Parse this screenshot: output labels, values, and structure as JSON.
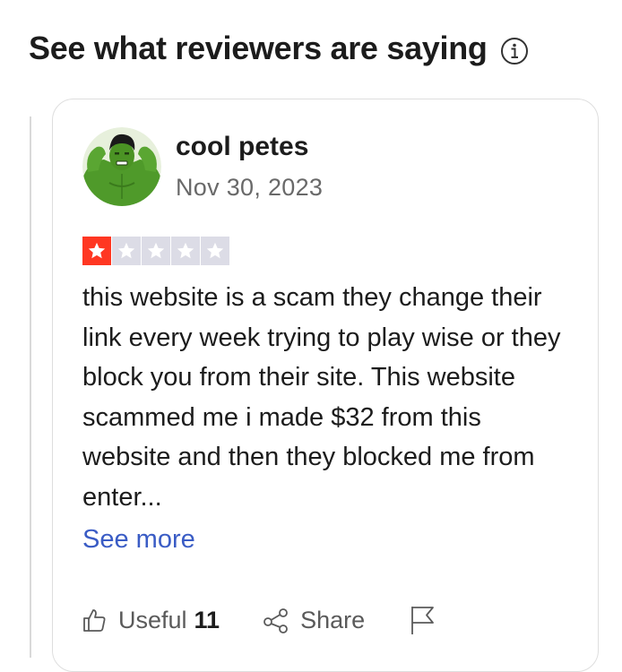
{
  "section": {
    "title": "See what reviewers are saying",
    "info_icon": "info-circle-icon"
  },
  "review": {
    "reviewer_name": "cool petes",
    "date": "Nov 30, 2023",
    "rating": 1,
    "rating_max": 5,
    "rating_colors": {
      "filled": "#ff3722",
      "empty": "#dcdce6"
    },
    "text": "this website is a scam they change their link every week trying to play wise or they block you from their site. This website scammed me i made $32 from this website and then they blocked me from enter...",
    "see_more_label": "See more",
    "actions": {
      "useful_label": "Useful",
      "useful_count": "11",
      "share_label": "Share",
      "flag_icon": "flag-icon"
    }
  },
  "colors": {
    "link": "#3a5cc5",
    "muted_text": "#696969",
    "card_border": "#dedede"
  }
}
